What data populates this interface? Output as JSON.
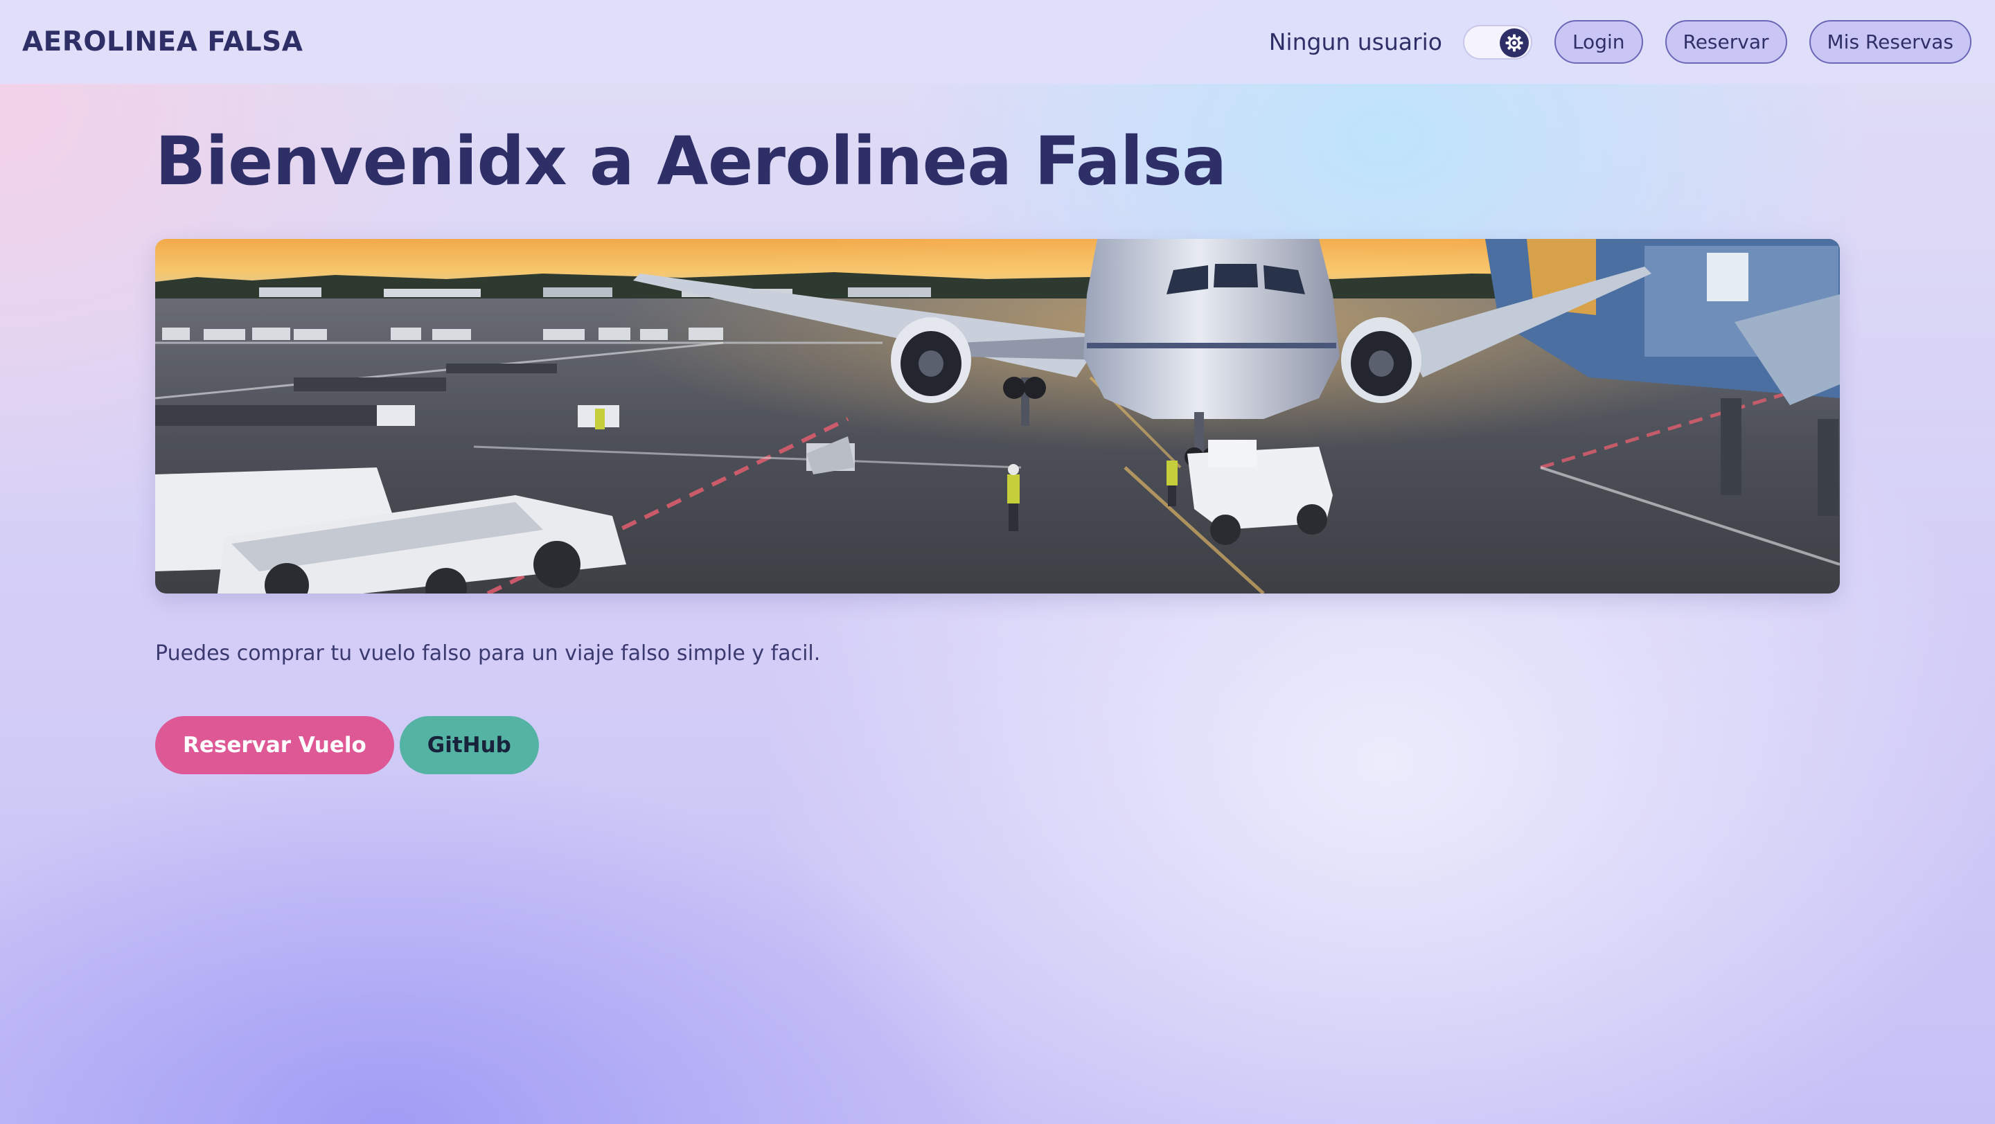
{
  "header": {
    "brand": "AEROLINEA FALSA",
    "user_status": "Ningun usuario",
    "theme_toggle_icon": "gear-icon",
    "nav": {
      "login": "Login",
      "reserve": "Reservar",
      "my_reservations": "Mis Reservas"
    }
  },
  "main": {
    "title": "Bienvenidx a Aerolinea Falsa",
    "hero_image_icon": "airplane-on-tarmac-photo",
    "tagline": "Puedes comprar tu vuelo falso para un viaje falso simple y facil.",
    "buttons": {
      "primary": "Reservar Vuelo",
      "secondary": "GitHub"
    }
  },
  "colors": {
    "primary_button": "#dd5895",
    "secondary_button": "#54b3a3",
    "nav_pill": "#c9c6f6",
    "text": "#2f2f68"
  }
}
